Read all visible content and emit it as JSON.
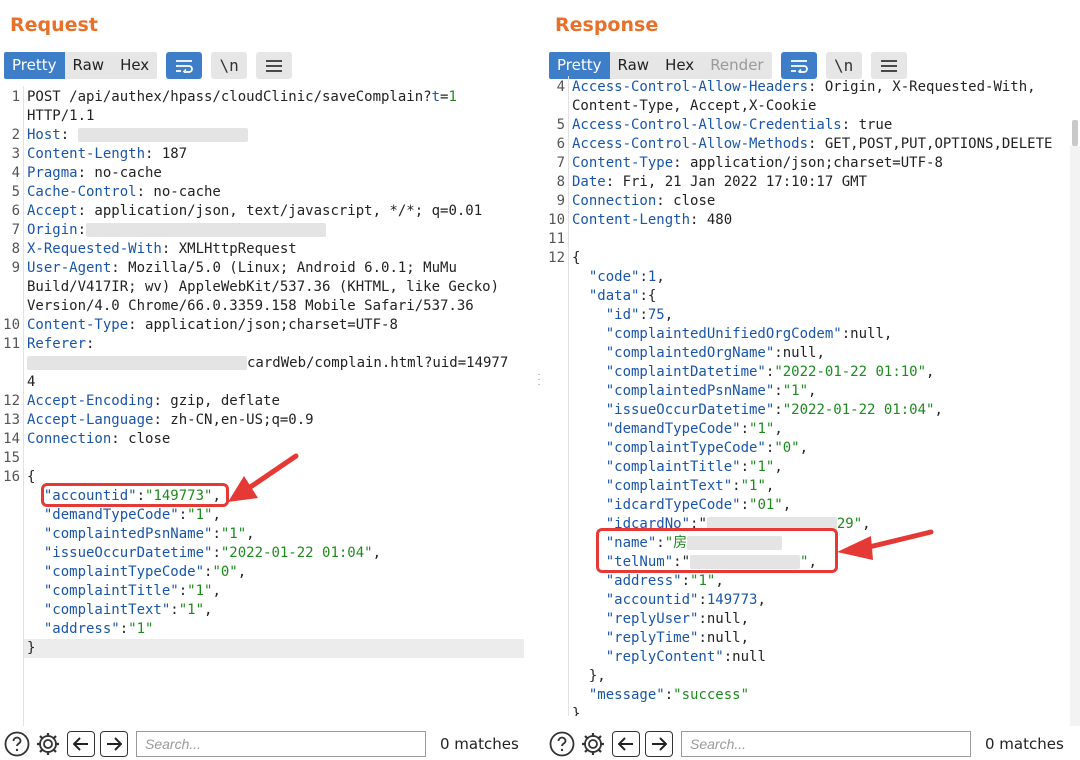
{
  "request": {
    "title": "Request",
    "tabs": [
      "Pretty",
      "Raw",
      "Hex"
    ],
    "active_tab": "Pretty",
    "search_placeholder": "Search...",
    "matches": "0 matches",
    "lines": [
      {
        "n": "1",
        "parts": [
          {
            "t": "POST /api/authex/hpass/cloudClinic/saveComplain?"
          },
          {
            "t": "t",
            "c": "hk"
          },
          {
            "t": "="
          },
          {
            "t": "1",
            "c": "js"
          }
        ]
      },
      {
        "n": "",
        "parts": [
          {
            "t": "HTTP/1.1"
          }
        ]
      },
      {
        "n": "2",
        "parts": [
          {
            "t": "Host",
            "c": "hk"
          },
          {
            "t": ": "
          }
        ],
        "blur": 170
      },
      {
        "n": "3",
        "parts": [
          {
            "t": "Content-Length",
            "c": "hk"
          },
          {
            "t": ": 187"
          }
        ]
      },
      {
        "n": "4",
        "parts": [
          {
            "t": "Pragma",
            "c": "hk"
          },
          {
            "t": ": no-cache"
          }
        ]
      },
      {
        "n": "5",
        "parts": [
          {
            "t": "Cache-Control",
            "c": "hk"
          },
          {
            "t": ": no-cache"
          }
        ]
      },
      {
        "n": "6",
        "parts": [
          {
            "t": "Accept",
            "c": "hk"
          },
          {
            "t": ": application/json, text/javascript, */*; q=0.01"
          }
        ]
      },
      {
        "n": "7",
        "parts": [
          {
            "t": "Origin",
            "c": "hk"
          },
          {
            "t": ":"
          }
        ],
        "blur": 240
      },
      {
        "n": "8",
        "parts": [
          {
            "t": "X-Requested-With",
            "c": "hk"
          },
          {
            "t": ": XMLHttpRequest"
          }
        ]
      },
      {
        "n": "9",
        "parts": [
          {
            "t": "User-Agent",
            "c": "hk"
          },
          {
            "t": ": Mozilla/5.0 (Linux; Android 6.0.1; MuMu"
          }
        ]
      },
      {
        "n": "",
        "parts": [
          {
            "t": "Build/V417IR; wv) AppleWebKit/537.36 (KHTML, like Gecko)"
          }
        ]
      },
      {
        "n": "",
        "parts": [
          {
            "t": "Version/4.0 Chrome/66.0.3359.158 Mobile Safari/537.36"
          }
        ]
      },
      {
        "n": "10",
        "parts": [
          {
            "t": "Content-Type",
            "c": "hk"
          },
          {
            "t": ": application/json;charset=UTF-8"
          }
        ]
      },
      {
        "n": "11",
        "parts": [
          {
            "t": "Referer",
            "c": "hk"
          },
          {
            "t": ":"
          }
        ]
      },
      {
        "n": "",
        "prefix_blur": 220,
        "parts": [
          {
            "t": "cardWeb/complain.html?uid=14977"
          }
        ]
      },
      {
        "n": "",
        "parts": [
          {
            "t": "4"
          }
        ]
      },
      {
        "n": "12",
        "parts": [
          {
            "t": "Accept-Encoding",
            "c": "hk"
          },
          {
            "t": ": gzip, deflate"
          }
        ]
      },
      {
        "n": "13",
        "parts": [
          {
            "t": "Accept-Language",
            "c": "hk"
          },
          {
            "t": ": zh-CN,en-US;q=0.9"
          }
        ]
      },
      {
        "n": "14",
        "parts": [
          {
            "t": "Connection",
            "c": "hk"
          },
          {
            "t": ": close"
          }
        ]
      },
      {
        "n": "15",
        "parts": []
      },
      {
        "n": "16",
        "parts": [
          {
            "t": "{"
          }
        ]
      },
      {
        "n": "",
        "parts": [
          {
            "t": "  "
          },
          {
            "t": "\"accountid\"",
            "c": "jk"
          },
          {
            "t": ":"
          },
          {
            "t": "\"149773\"",
            "c": "js"
          },
          {
            "t": ","
          }
        ]
      },
      {
        "n": "",
        "parts": [
          {
            "t": "  "
          },
          {
            "t": "\"demandTypeCode\"",
            "c": "jk"
          },
          {
            "t": ":"
          },
          {
            "t": "\"1\"",
            "c": "js"
          },
          {
            "t": ","
          }
        ]
      },
      {
        "n": "",
        "parts": [
          {
            "t": "  "
          },
          {
            "t": "\"complaintedPsnName\"",
            "c": "jk"
          },
          {
            "t": ":"
          },
          {
            "t": "\"1\"",
            "c": "js"
          },
          {
            "t": ","
          }
        ]
      },
      {
        "n": "",
        "parts": [
          {
            "t": "  "
          },
          {
            "t": "\"issueOccurDatetime\"",
            "c": "jk"
          },
          {
            "t": ":"
          },
          {
            "t": "\"2022-01-22 01:04\"",
            "c": "js"
          },
          {
            "t": ","
          }
        ]
      },
      {
        "n": "",
        "parts": [
          {
            "t": "  "
          },
          {
            "t": "\"complaintTypeCode\"",
            "c": "jk"
          },
          {
            "t": ":"
          },
          {
            "t": "\"0\"",
            "c": "js"
          },
          {
            "t": ","
          }
        ]
      },
      {
        "n": "",
        "parts": [
          {
            "t": "  "
          },
          {
            "t": "\"complaintTitle\"",
            "c": "jk"
          },
          {
            "t": ":"
          },
          {
            "t": "\"1\"",
            "c": "js"
          },
          {
            "t": ","
          }
        ]
      },
      {
        "n": "",
        "parts": [
          {
            "t": "  "
          },
          {
            "t": "\"complaintText\"",
            "c": "jk"
          },
          {
            "t": ":"
          },
          {
            "t": "\"1\"",
            "c": "js"
          },
          {
            "t": ","
          }
        ]
      },
      {
        "n": "",
        "parts": [
          {
            "t": "  "
          },
          {
            "t": "\"address\"",
            "c": "jk"
          },
          {
            "t": ":"
          },
          {
            "t": "\"1\"",
            "c": "js"
          }
        ]
      },
      {
        "n": "",
        "parts": [
          {
            "t": "}"
          }
        ],
        "highlight": true
      }
    ]
  },
  "response": {
    "title": "Response",
    "tabs": [
      "Pretty",
      "Raw",
      "Hex",
      "Render"
    ],
    "active_tab": "Pretty",
    "disabled_tab": "Render",
    "search_placeholder": "Search...",
    "matches": "0 matches",
    "lines": [
      {
        "n": "4",
        "parts": [
          {
            "t": "Access-Control-Allow-Headers",
            "c": "hk"
          },
          {
            "t": ": Origin, X-Requested-With,"
          }
        ]
      },
      {
        "n": "",
        "parts": [
          {
            "t": "Content-Type, Accept,X-Cookie"
          }
        ]
      },
      {
        "n": "5",
        "parts": [
          {
            "t": "Access-Control-Allow-Credentials",
            "c": "hk"
          },
          {
            "t": ": true"
          }
        ]
      },
      {
        "n": "6",
        "parts": [
          {
            "t": "Access-Control-Allow-Methods",
            "c": "hk"
          },
          {
            "t": ": GET,POST,PUT,OPTIONS,DELETE"
          }
        ]
      },
      {
        "n": "7",
        "parts": [
          {
            "t": "Content-Type",
            "c": "hk"
          },
          {
            "t": ": application/json;charset=UTF-8"
          }
        ]
      },
      {
        "n": "8",
        "parts": [
          {
            "t": "Date",
            "c": "hk"
          },
          {
            "t": ": Fri, 21 Jan 2022 17:10:17 GMT"
          }
        ]
      },
      {
        "n": "9",
        "parts": [
          {
            "t": "Connection",
            "c": "hk"
          },
          {
            "t": ": close"
          }
        ]
      },
      {
        "n": "10",
        "parts": [
          {
            "t": "Content-Length",
            "c": "hk"
          },
          {
            "t": ": 480"
          }
        ]
      },
      {
        "n": "11",
        "parts": []
      },
      {
        "n": "12",
        "parts": [
          {
            "t": "{"
          }
        ]
      },
      {
        "n": "",
        "parts": [
          {
            "t": "  "
          },
          {
            "t": "\"code\"",
            "c": "jk"
          },
          {
            "t": ":"
          },
          {
            "t": "1",
            "c": "jn"
          },
          {
            "t": ","
          }
        ]
      },
      {
        "n": "",
        "parts": [
          {
            "t": "  "
          },
          {
            "t": "\"data\"",
            "c": "jk"
          },
          {
            "t": ":{"
          }
        ]
      },
      {
        "n": "",
        "parts": [
          {
            "t": "    "
          },
          {
            "t": "\"id\"",
            "c": "jk"
          },
          {
            "t": ":"
          },
          {
            "t": "75",
            "c": "jn"
          },
          {
            "t": ","
          }
        ]
      },
      {
        "n": "",
        "parts": [
          {
            "t": "    "
          },
          {
            "t": "\"complaintedUnifiedOrgCodem\"",
            "c": "jk"
          },
          {
            "t": ":null,"
          }
        ]
      },
      {
        "n": "",
        "parts": [
          {
            "t": "    "
          },
          {
            "t": "\"complaintedOrgName\"",
            "c": "jk"
          },
          {
            "t": ":null,"
          }
        ]
      },
      {
        "n": "",
        "parts": [
          {
            "t": "    "
          },
          {
            "t": "\"complaintDatetime\"",
            "c": "jk"
          },
          {
            "t": ":"
          },
          {
            "t": "\"2022-01-22 01:10\"",
            "c": "js"
          },
          {
            "t": ","
          }
        ]
      },
      {
        "n": "",
        "parts": [
          {
            "t": "    "
          },
          {
            "t": "\"complaintedPsnName\"",
            "c": "jk"
          },
          {
            "t": ":"
          },
          {
            "t": "\"1\"",
            "c": "js"
          },
          {
            "t": ","
          }
        ]
      },
      {
        "n": "",
        "parts": [
          {
            "t": "    "
          },
          {
            "t": "\"issueOccurDatetime\"",
            "c": "jk"
          },
          {
            "t": ":"
          },
          {
            "t": "\"2022-01-22 01:04\"",
            "c": "js"
          },
          {
            "t": ","
          }
        ]
      },
      {
        "n": "",
        "parts": [
          {
            "t": "    "
          },
          {
            "t": "\"demandTypeCode\"",
            "c": "jk"
          },
          {
            "t": ":"
          },
          {
            "t": "\"1\"",
            "c": "js"
          },
          {
            "t": ","
          }
        ]
      },
      {
        "n": "",
        "parts": [
          {
            "t": "    "
          },
          {
            "t": "\"complaintTypeCode\"",
            "c": "jk"
          },
          {
            "t": ":"
          },
          {
            "t": "\"0\"",
            "c": "js"
          },
          {
            "t": ","
          }
        ]
      },
      {
        "n": "",
        "parts": [
          {
            "t": "    "
          },
          {
            "t": "\"complaintTitle\"",
            "c": "jk"
          },
          {
            "t": ":"
          },
          {
            "t": "\"1\"",
            "c": "js"
          },
          {
            "t": ","
          }
        ]
      },
      {
        "n": "",
        "parts": [
          {
            "t": "    "
          },
          {
            "t": "\"complaintText\"",
            "c": "jk"
          },
          {
            "t": ":"
          },
          {
            "t": "\"1\"",
            "c": "js"
          },
          {
            "t": ","
          }
        ]
      },
      {
        "n": "",
        "parts": [
          {
            "t": "    "
          },
          {
            "t": "\"idcardTypeCode\"",
            "c": "jk"
          },
          {
            "t": ":"
          },
          {
            "t": "\"01\"",
            "c": "js"
          },
          {
            "t": ","
          }
        ]
      },
      {
        "n": "",
        "parts": [
          {
            "t": "    "
          },
          {
            "t": "\"idcardNo\"",
            "c": "jk"
          },
          {
            "t": ":\""
          }
        ],
        "mid_blur": 130,
        "tail": [
          {
            "t": "29\"",
            "c": "js"
          },
          {
            "t": ","
          }
        ]
      },
      {
        "n": "",
        "parts": [
          {
            "t": "    "
          },
          {
            "t": "\"name\"",
            "c": "jk"
          },
          {
            "t": ":"
          },
          {
            "t": "\"房",
            "c": "js"
          }
        ],
        "blur": 95
      },
      {
        "n": "",
        "parts": [
          {
            "t": "    "
          },
          {
            "t": "\"telNum\"",
            "c": "jk"
          },
          {
            "t": ":\""
          }
        ],
        "mid_blur": 110,
        "tail": [
          {
            "t": "\"",
            "c": "js"
          },
          {
            "t": ","
          }
        ]
      },
      {
        "n": "",
        "parts": [
          {
            "t": "    "
          },
          {
            "t": "\"address\"",
            "c": "jk"
          },
          {
            "t": ":"
          },
          {
            "t": "\"1\"",
            "c": "js"
          },
          {
            "t": ","
          }
        ]
      },
      {
        "n": "",
        "parts": [
          {
            "t": "    "
          },
          {
            "t": "\"accountid\"",
            "c": "jk"
          },
          {
            "t": ":"
          },
          {
            "t": "149773",
            "c": "jn"
          },
          {
            "t": ","
          }
        ]
      },
      {
        "n": "",
        "parts": [
          {
            "t": "    "
          },
          {
            "t": "\"replyUser\"",
            "c": "jk"
          },
          {
            "t": ":null,"
          }
        ]
      },
      {
        "n": "",
        "parts": [
          {
            "t": "    "
          },
          {
            "t": "\"replyTime\"",
            "c": "jk"
          },
          {
            "t": ":null,"
          }
        ]
      },
      {
        "n": "",
        "parts": [
          {
            "t": "    "
          },
          {
            "t": "\"replyContent\"",
            "c": "jk"
          },
          {
            "t": ":null"
          }
        ]
      },
      {
        "n": "",
        "parts": [
          {
            "t": "  },"
          }
        ]
      },
      {
        "n": "",
        "parts": [
          {
            "t": "  "
          },
          {
            "t": "\"message\"",
            "c": "jk"
          },
          {
            "t": ":"
          },
          {
            "t": "\"success\"",
            "c": "js"
          }
        ]
      },
      {
        "n": "",
        "parts": [
          {
            "t": "}"
          }
        ]
      }
    ]
  },
  "icons": {
    "pretty_toggle": "wrap-lines-icon",
    "newline_toggle": "\\n",
    "menu": "hamburger-menu-icon",
    "help": "help-icon",
    "settings": "gear-icon",
    "prev": "arrow-left-icon",
    "next": "arrow-right-icon",
    "layout": [
      "split-horizontal-icon",
      "split-vertical-icon",
      "tabs-icon"
    ]
  },
  "colors": {
    "accent": "#e8702a",
    "active_tab": "#3e7ec9",
    "header_key": "#1a55a8",
    "json_string": "#1f8a1f",
    "highlight_box": "#e53935"
  }
}
